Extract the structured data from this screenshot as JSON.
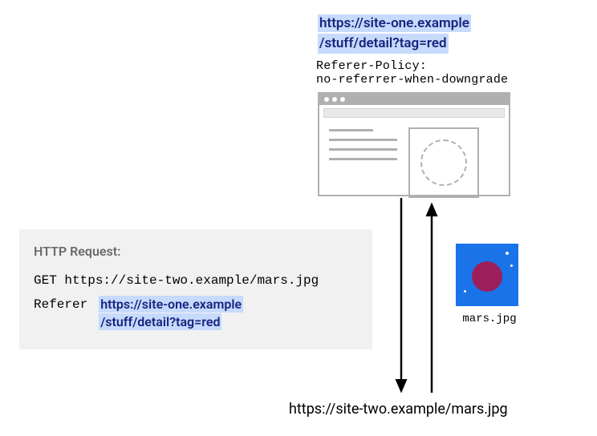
{
  "top_url_line1": "https://site-one.example",
  "top_url_line2": "/stuff/detail?tag=red",
  "policy_line1": "Referer-Policy:",
  "policy_line2": "no-referrer-when-downgrade",
  "panel": {
    "label": "HTTP Request:",
    "get": "GET https://site-two.example/mars.jpg",
    "referer_key": "Referer",
    "referer_line1": "https://site-one.example",
    "referer_line2": "/stuff/detail?tag=red"
  },
  "mars_label": "mars.jpg",
  "bottom_url": "https://site-two.example/mars.jpg"
}
